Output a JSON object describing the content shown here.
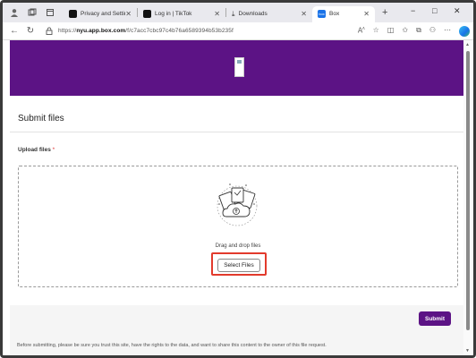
{
  "browser": {
    "tabs": [
      {
        "label": "Privacy and Settings | TikTok",
        "favicon_color": "#111111"
      },
      {
        "label": "Log in | TikTok",
        "favicon_color": "#111111"
      },
      {
        "label": "Downloads",
        "favicon_color": ""
      },
      {
        "label": "Box",
        "favicon_color": "#1a73e8",
        "favicon_text": "box"
      }
    ],
    "new_tab": "+",
    "url_prefix": "https://",
    "url_host": "nyu.app.box.com",
    "url_path": "/f/c7acc7cbc97c4b76a6589394b53b235f",
    "window_controls": {
      "minimize": "−",
      "maximize": "□",
      "close": "✕"
    }
  },
  "page": {
    "title": "Submit files",
    "upload_label": "Upload files",
    "required_mark": "*",
    "drag_text": "Drag and drop files",
    "select_button": "Select Files",
    "submit_button": "Submit",
    "notice": "Before submitting, please be sure you trust this site, have the rights to the data, and want to share this content to the owner of this file request."
  },
  "colors": {
    "brand": "#5c1385",
    "highlight": "#e23a2c"
  }
}
